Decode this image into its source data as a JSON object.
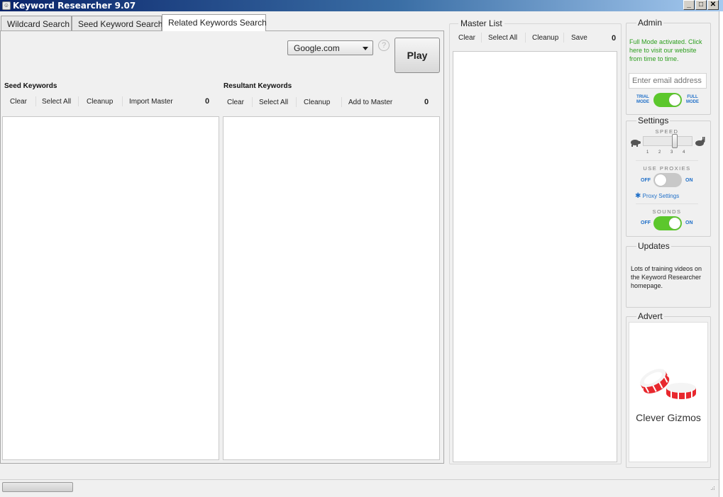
{
  "window": {
    "title": "Keyword Researcher 9.07",
    "icon": "app-icon",
    "controls": {
      "minimize": "_",
      "maximize": "□",
      "close": "✕"
    }
  },
  "tabs": [
    {
      "label": "Wildcard Search",
      "active": false
    },
    {
      "label": "Seed Keyword Search",
      "active": false
    },
    {
      "label": "Related Keywords Search",
      "active": true
    }
  ],
  "search": {
    "engine_selected": "Google.com",
    "help_icon": "?",
    "play_label": "Play"
  },
  "seed": {
    "title": "Seed Keywords",
    "toolbar": [
      "Clear",
      "Select All",
      "Cleanup",
      "Import Master"
    ],
    "count": "0"
  },
  "resultant": {
    "title": "Resultant Keywords",
    "toolbar": [
      "Clear",
      "Select All",
      "Cleanup",
      "Add to Master"
    ],
    "count": "0"
  },
  "master": {
    "title": "Master List",
    "toolbar": [
      "Clear",
      "Select All",
      "Cleanup",
      "Save"
    ],
    "count": "0"
  },
  "admin": {
    "title": "Admin",
    "message": "Full Mode activated. Click here to visit our website from time to time.",
    "email_placeholder": "Enter email address",
    "trial_label": "TRIAL MODE",
    "full_label": "FULL MODE"
  },
  "settings": {
    "title": "Settings",
    "speed_caption": "SPEED",
    "speed_ticks": [
      "1",
      "2",
      "3",
      "4"
    ],
    "speed_value": 3,
    "proxies_caption": "USE PROXIES",
    "proxies_off": "OFF",
    "proxies_on": "ON",
    "proxy_settings_link": "Proxy Settings",
    "sounds_caption": "SOUNDS",
    "sounds_off": "OFF",
    "sounds_on": "ON"
  },
  "updates": {
    "title": "Updates",
    "message": "Lots of training videos on the Keyword Researcher homepage."
  },
  "advert": {
    "title": "Advert",
    "brand": "Clever Gizmos"
  },
  "colors": {
    "accent_green": "#5cc72c",
    "link_blue": "#1f6fc8",
    "message_green": "#2c9e1e",
    "candy_red": "#e8282e"
  }
}
